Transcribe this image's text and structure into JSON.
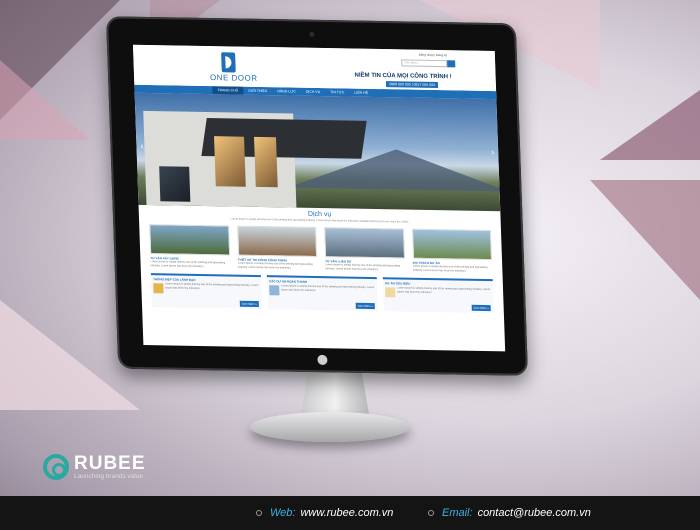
{
  "site": {
    "logo_text": "ONE DOOR",
    "top_links": "Đăng nhập | Đăng ký",
    "search_placeholder": "Tìm kiếm...",
    "slogan": "NIỀM TIN CỦA MỌI CÔNG TRÌNH !",
    "hotline": "0988 000 000 | 0917 000 000",
    "nav": [
      "TRANG CHỦ",
      "GIỚI THIỆU",
      "NĂNG LỰC",
      "DỊCH VỤ",
      "TIN TỨC",
      "LIÊN HỆ"
    ],
    "section_title": "Dịch vụ",
    "intro": "Lorem Ipsum is simply dummy text of the printing and typesetting industry. Lorem Ipsum has been the industry's standard dummy text ever since the 1500s.",
    "services": [
      {
        "title": "TƯ VẤN XÂY DỰNG",
        "text": "Lorem Ipsum is simply dummy text of the printing and typesetting industry. Lorem Ipsum has been the industry's"
      },
      {
        "title": "THIẾT KẾ THI CÔNG CÔNG TRÌNH",
        "text": "Lorem Ipsum is simply dummy text of the printing and typesetting industry. Lorem Ipsum has been the industry's"
      },
      {
        "title": "TƯ VẤN LUẬN SỬ",
        "text": "Lorem Ipsum is simply dummy text of the printing and typesetting industry. Lorem Ipsum has been the industry's"
      },
      {
        "title": "ĐỊA TRẠCH DỰ ÁN",
        "text": "Lorem Ipsum is simply dummy text of the printing and typesetting industry. Lorem Ipsum has been the industry's"
      }
    ],
    "boxes": [
      {
        "title": "THÔNG ĐIỆP CỦA LÃNH ĐẠO",
        "text": "Lorem Ipsum is simply dummy text of the printing and typesetting industry. Lorem Ipsum has been the industry's",
        "button": "Xem thêm »"
      },
      {
        "title": "CÁC DỰ ÁN HOÀN THÀNH",
        "text": "Lorem Ipsum is simply dummy text of the printing and typesetting industry. Lorem Ipsum has been the industry's",
        "button": "Xem thêm »"
      },
      {
        "title": "DỰ ÁN TIÊU BIỂU",
        "text": "Lorem Ipsum is simply dummy text of the printing and typesetting industry. Lorem Ipsum has been the industry's",
        "button": "Xem thêm »"
      }
    ]
  },
  "brand": {
    "name": "RUBEE",
    "tagline": "Launching brands value"
  },
  "footer": {
    "web_label": "Web:",
    "web_value": "www.rubee.com.vn",
    "email_label": "Email:",
    "email_value": "contact@rubee.com.vn"
  },
  "colors": {
    "accent": "#1f6fb8",
    "brand_teal": "#2aa9a0",
    "footer_label": "#3db2e3",
    "footer_bg": "#141414"
  }
}
